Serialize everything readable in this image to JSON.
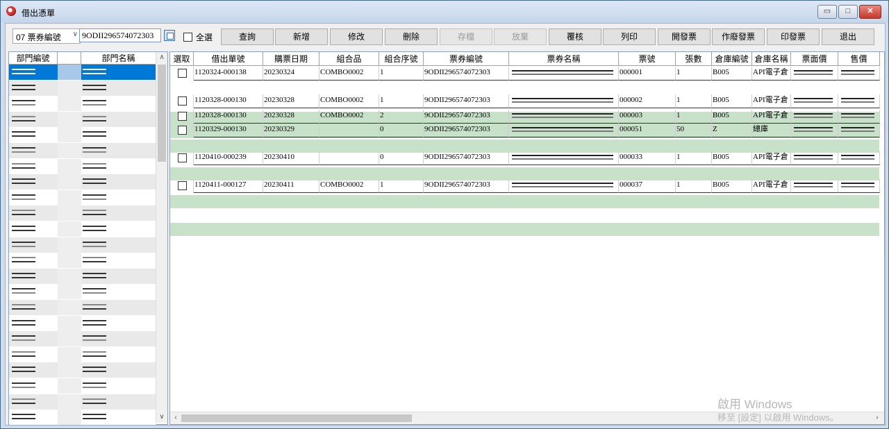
{
  "window": {
    "title": "借出憑單"
  },
  "toolbar": {
    "field_select": "07 票券編號",
    "search_value": "9ODII296574072303",
    "select_all_label": "全選",
    "buttons": [
      {
        "label": "查詢",
        "enabled": true
      },
      {
        "label": "新增",
        "enabled": true
      },
      {
        "label": "修改",
        "enabled": true
      },
      {
        "label": "刪除",
        "enabled": true
      },
      {
        "label": "存檔",
        "enabled": false
      },
      {
        "label": "放棄",
        "enabled": false
      },
      {
        "label": "覆核",
        "enabled": true
      },
      {
        "label": "列印",
        "enabled": true
      },
      {
        "label": "開發票",
        "enabled": true
      },
      {
        "label": "作廢發票",
        "enabled": true
      },
      {
        "label": "印發票",
        "enabled": true
      },
      {
        "label": "退出",
        "enabled": true
      }
    ]
  },
  "left_list": {
    "headers": [
      "部門編號",
      "部門名稱"
    ],
    "row_count": 23,
    "selected_row": 0
  },
  "grid": {
    "headers": [
      "選取",
      "借出單號",
      "購票日期",
      "組合品",
      "組合序號",
      "票券編號",
      "票券名稱",
      "票號",
      "張數",
      "倉庫編號",
      "倉庫名稱",
      "票面價",
      "售價"
    ],
    "rows": [
      {
        "order_no": "1120324-000138",
        "date": "20230324",
        "combo": "COMBO0002",
        "seq": "1",
        "ticket_no": "9ODII296574072303",
        "serial": "000001",
        "qty": "1",
        "wh_no": "B005",
        "wh_name": "API電子倉"
      },
      {
        "order_no": "1120328-000130",
        "date": "20230328",
        "combo": "COMBO0002",
        "seq": "1",
        "ticket_no": "9ODII296574072303",
        "serial": "000002",
        "qty": "1",
        "wh_no": "B005",
        "wh_name": "API電子倉"
      },
      {
        "order_no": "1120328-000130",
        "date": "20230328",
        "combo": "COMBO0002",
        "seq": "2",
        "ticket_no": "9ODII296574072303",
        "serial": "000003",
        "qty": "1",
        "wh_no": "B005",
        "wh_name": "API電子倉"
      },
      {
        "order_no": "1120329-000130",
        "date": "20230329",
        "combo": "",
        "seq": "0",
        "ticket_no": "9ODII296574072303",
        "serial": "000051",
        "qty": "50",
        "wh_no": "Z",
        "wh_name": "總庫"
      },
      {
        "order_no": "1120410-000239",
        "date": "20230410",
        "combo": "",
        "seq": "0",
        "ticket_no": "9ODII296574072303",
        "serial": "000033",
        "qty": "1",
        "wh_no": "B005",
        "wh_name": "API電子倉"
      },
      {
        "order_no": "1120411-000127",
        "date": "20230411",
        "combo": "COMBO0002",
        "seq": "1",
        "ticket_no": "9ODII296574072303",
        "serial": "000037",
        "qty": "1",
        "wh_no": "B005",
        "wh_name": "API電子倉"
      }
    ]
  },
  "watermark": {
    "line1": "啟用 Windows",
    "line2": "移至 [設定] 以啟用 Windows。"
  },
  "colors": {
    "selection": "#0078d7",
    "group_row": "#c7e2c9",
    "title_bar": "#c5d6eb"
  }
}
